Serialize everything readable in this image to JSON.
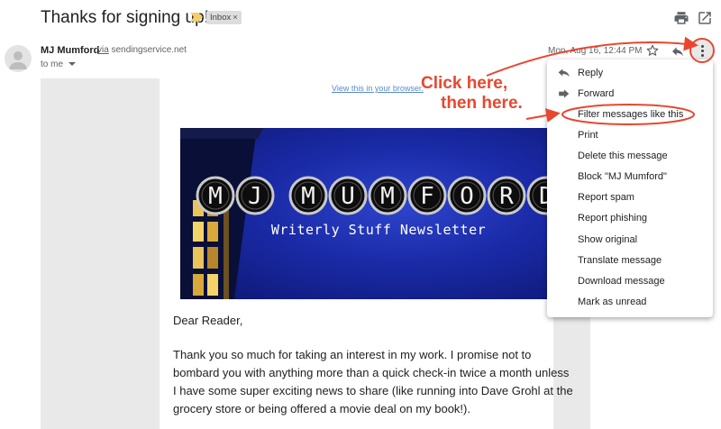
{
  "header": {
    "subject": "Thanks for signing up!",
    "label": "Inbox"
  },
  "sender": {
    "name": "MJ Mumford",
    "via_word": "via",
    "via_domain": "sendingservice.net",
    "to": "to me",
    "date": "Mon, Aug 16, 12:44 PM"
  },
  "email": {
    "view_link": "View this in your browser.",
    "banner_title_letters": [
      "M",
      "J",
      "M",
      "U",
      "M",
      "F",
      "O",
      "R",
      "D"
    ],
    "banner_subtitle": "Writerly Stuff Newsletter",
    "greeting": "Dear Reader,",
    "paragraph": "Thank you so much for taking an interest in my work. I promise not to bombard you with anything more than a quick check-in twice a month unless I have some super exciting news to share (like running into Dave Grohl at the grocery store or being offered a movie deal on my book!)."
  },
  "menu": {
    "items": [
      {
        "label": "Reply",
        "icon": "reply-icon"
      },
      {
        "label": "Forward",
        "icon": "forward-icon"
      },
      {
        "label": "Filter messages like this"
      },
      {
        "label": "Print"
      },
      {
        "label": "Delete this message"
      },
      {
        "label": "Block \"MJ Mumford\""
      },
      {
        "label": "Report spam"
      },
      {
        "label": "Report phishing"
      },
      {
        "label": "Show original"
      },
      {
        "label": "Translate message"
      },
      {
        "label": "Download message"
      },
      {
        "label": "Mark as unread"
      }
    ]
  },
  "annotation": {
    "line1": "Click here,",
    "line2": "then here.",
    "color": "#e8472f"
  }
}
